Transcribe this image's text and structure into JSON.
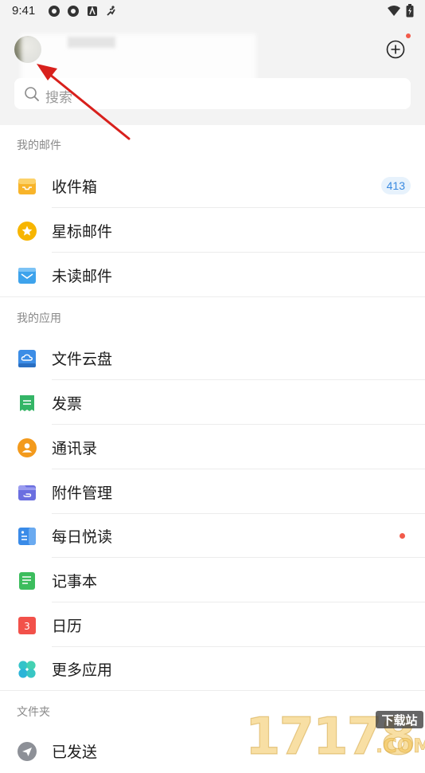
{
  "status_bar": {
    "time": "9:41"
  },
  "search": {
    "placeholder": "搜索"
  },
  "sections": [
    {
      "title": "我的邮件"
    },
    {
      "title": "我的应用"
    },
    {
      "title": "文件夹"
    }
  ],
  "mail_items": [
    {
      "label": "收件箱",
      "badge": "413",
      "icon": "inbox-icon"
    },
    {
      "label": "星标邮件",
      "icon": "star-icon"
    },
    {
      "label": "未读邮件",
      "icon": "unread-mail-icon"
    }
  ],
  "app_items": [
    {
      "label": "文件云盘",
      "icon": "cloud-drive-icon"
    },
    {
      "label": "发票",
      "icon": "invoice-icon"
    },
    {
      "label": "通讯录",
      "icon": "contacts-icon"
    },
    {
      "label": "附件管理",
      "icon": "attachment-icon"
    },
    {
      "label": "每日悦读",
      "icon": "daily-reading-icon"
    },
    {
      "label": "记事本",
      "icon": "notepad-icon"
    },
    {
      "label": "日历",
      "icon": "calendar-icon",
      "calendar_day": "3"
    },
    {
      "label": "更多应用",
      "icon": "more-apps-icon"
    }
  ],
  "folder_items": [
    {
      "label": "已发送",
      "icon": "sent-icon"
    }
  ],
  "watermark": {
    "main": "17178",
    "sub": "下载站",
    "domain": ".COM"
  },
  "colors": {
    "header_bg": "#f3f3f3",
    "badge_text": "#3a8ae0",
    "badge_bg": "#e7f2fc",
    "red_dot": "#f25a4a",
    "annotation_arrow": "#d8201c"
  }
}
